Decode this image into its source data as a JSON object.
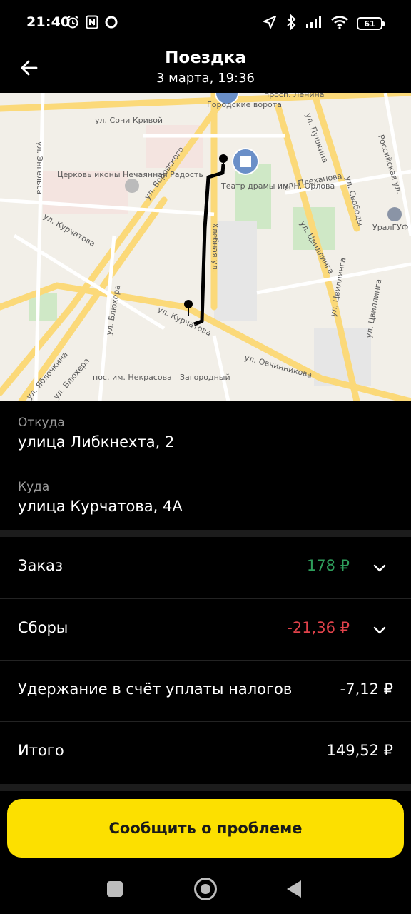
{
  "status_bar": {
    "time": "21:40",
    "battery": "61",
    "left_icons": [
      "alarm-icon",
      "nfc-icon",
      "circle-icon"
    ],
    "right_icons": [
      "location-icon",
      "bluetooth-icon",
      "signal-icon",
      "wifi-icon",
      "battery-icon"
    ]
  },
  "header": {
    "title": "Поездка",
    "subtitle": "3 марта, 19:36",
    "back_icon": "arrow-left-icon"
  },
  "map": {
    "labels": [
      "просп. Ленина",
      "Городские ворота",
      "ул. Сони Кривой",
      "Церковь иконы Нечаянная Радость",
      "ул. Воровского",
      "Театр драмы им. Н. Орлова",
      "ул. Пушкина",
      "ул. Плеханова",
      "Российская ул.",
      "ул. Свободы",
      "УралГУФ",
      "ул. Энгельса",
      "ул. Курчатова",
      "Хлебная ул.",
      "ул. Цвиллинга",
      "ул. Блюхера",
      "ул. Овчинникова",
      "ул. Цвиллинга",
      "ул. Цвиллинга",
      "ул. Яблочкина",
      "ул. Блюхера",
      "пос. им. Некрасова",
      "Загородный",
      "ул. Цвиллинга"
    ],
    "marker_icon": "pin-icon"
  },
  "trip": {
    "from_label": "Откуда",
    "from_value": "улица Либкнехта, 2",
    "to_label": "Куда",
    "to_value": "улица Курчатова, 4А"
  },
  "payment": {
    "order_label": "Заказ",
    "order_value": "178 ₽",
    "fees_label": "Сборы",
    "fees_value": "-21,36 ₽",
    "tax_label": "Удержание в счёт уплаты налогов",
    "tax_value": "-7,12 ₽",
    "total_label": "Итого",
    "total_value": "149,52 ₽",
    "positive_color": "#2e9e5b",
    "negative_color": "#e0424a"
  },
  "action": {
    "report_label": "Сообщить о проблеме",
    "accent": "#fce000"
  },
  "nav": {
    "icons": [
      "recent-apps-icon",
      "home-icon",
      "back-icon"
    ]
  }
}
